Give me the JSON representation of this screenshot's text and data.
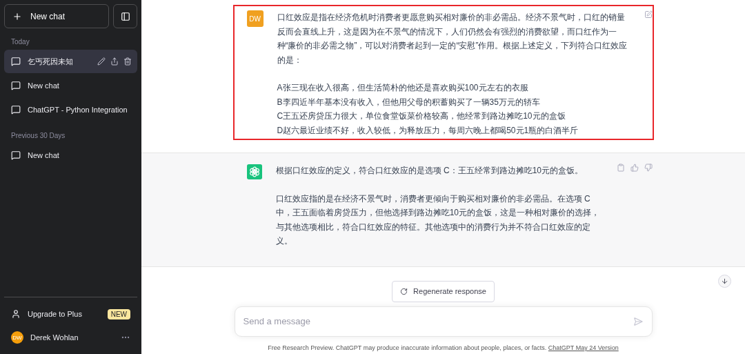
{
  "sidebar": {
    "new_chat_button": "New chat",
    "sections": [
      {
        "heading": "Today",
        "items": [
          {
            "label": "乞丐死因未知",
            "selected": true
          },
          {
            "label": "New chat",
            "selected": false
          },
          {
            "label": "ChatGPT - Python Integration",
            "selected": false
          }
        ]
      },
      {
        "heading": "Previous 30 Days",
        "items": [
          {
            "label": "New chat",
            "selected": false
          }
        ]
      }
    ],
    "upgrade": {
      "label": "Upgrade to Plus",
      "badge": "NEW"
    },
    "user": {
      "initials": "DW",
      "name": "Derek Wohlan"
    }
  },
  "messages": [
    {
      "kind": "user",
      "avatar": "DW",
      "highlighted": true,
      "paragraphs": [
        "口红效应是指在经济危机时消费者更愿意购买相对廉价的非必需品。经济不景气时，口红的销量反而会直线上升，这是因为在不景气的情况下，人们仍然会有强烈的消费欲望，而口红作为一种“廉价的非必需之物”，可以对消费者起到一定的“安慰”作用。根据上述定义，下列符合口红效应的是：",
        "A张三现在收入很高，但生活简朴的他还是喜欢购买100元左右的衣服\nB李四近半年基本没有收入，但他用父母的积蓄购买了一辆35万元的轿车\nC王五还房贷压力很大，单位食堂饭菜价格较高，他经常到路边摊吃10元的盒饭\nD赵六最近业绩不好，收入较低，为释放压力，每周六晚上都喝50元1瓶的白酒半斤"
      ]
    },
    {
      "kind": "assistant",
      "highlighted": false,
      "paragraphs": [
        "根据口红效应的定义，符合口红效应的是选项 C：王五经常到路边摊吃10元的盒饭。",
        "口红效应指的是在经济不景气时，消费者更倾向于购买相对廉价的非必需品。在选项 C 中，王五面临着房贷压力，但他选择到路边摊吃10元的盒饭，这是一种相对廉价的选择，与其他选项相比，符合口红效应的特征。其他选项中的消费行为并不符合口红效应的定义。"
      ]
    }
  ],
  "regenerate_button": "Regenerate response",
  "composer": {
    "placeholder": "Send a message"
  },
  "footer": {
    "text": "Free Research Preview. ChatGPT may produce inaccurate information about people, places, or facts.",
    "link": "ChatGPT May 24 Version"
  }
}
